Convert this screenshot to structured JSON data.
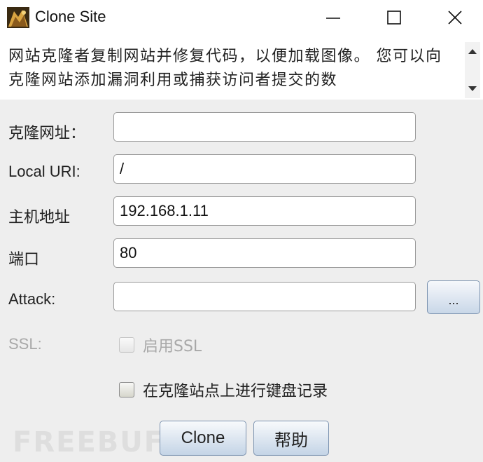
{
  "window": {
    "title": "Clone Site",
    "icon": "app-icon",
    "controls": [
      "minimize-icon",
      "maximize-icon",
      "close-icon"
    ]
  },
  "description": {
    "text": "网站克隆者复制网站并修复代码，以便加载图像。 您可以向克隆网站添加漏洞利用或捕获访问者提交的数"
  },
  "form": {
    "clone_url": {
      "label": "克隆网址：",
      "value": ""
    },
    "local_uri": {
      "label": "Local URI:",
      "value": "/"
    },
    "host": {
      "label": "主机地址",
      "value": "192.168.1.11"
    },
    "port": {
      "label": "端口",
      "value": "80"
    },
    "attack": {
      "label": "Attack:",
      "value": "",
      "browse_label": "..."
    },
    "ssl": {
      "label": "SSL:",
      "checkbox_label": "启用SSL",
      "checked": false,
      "enabled": false
    },
    "keylogger": {
      "checkbox_label": "在克隆站点上进行键盘记录",
      "checked": false
    }
  },
  "buttons": {
    "clone": "Clone",
    "help": "帮助"
  },
  "watermark": "FREEBUF"
}
